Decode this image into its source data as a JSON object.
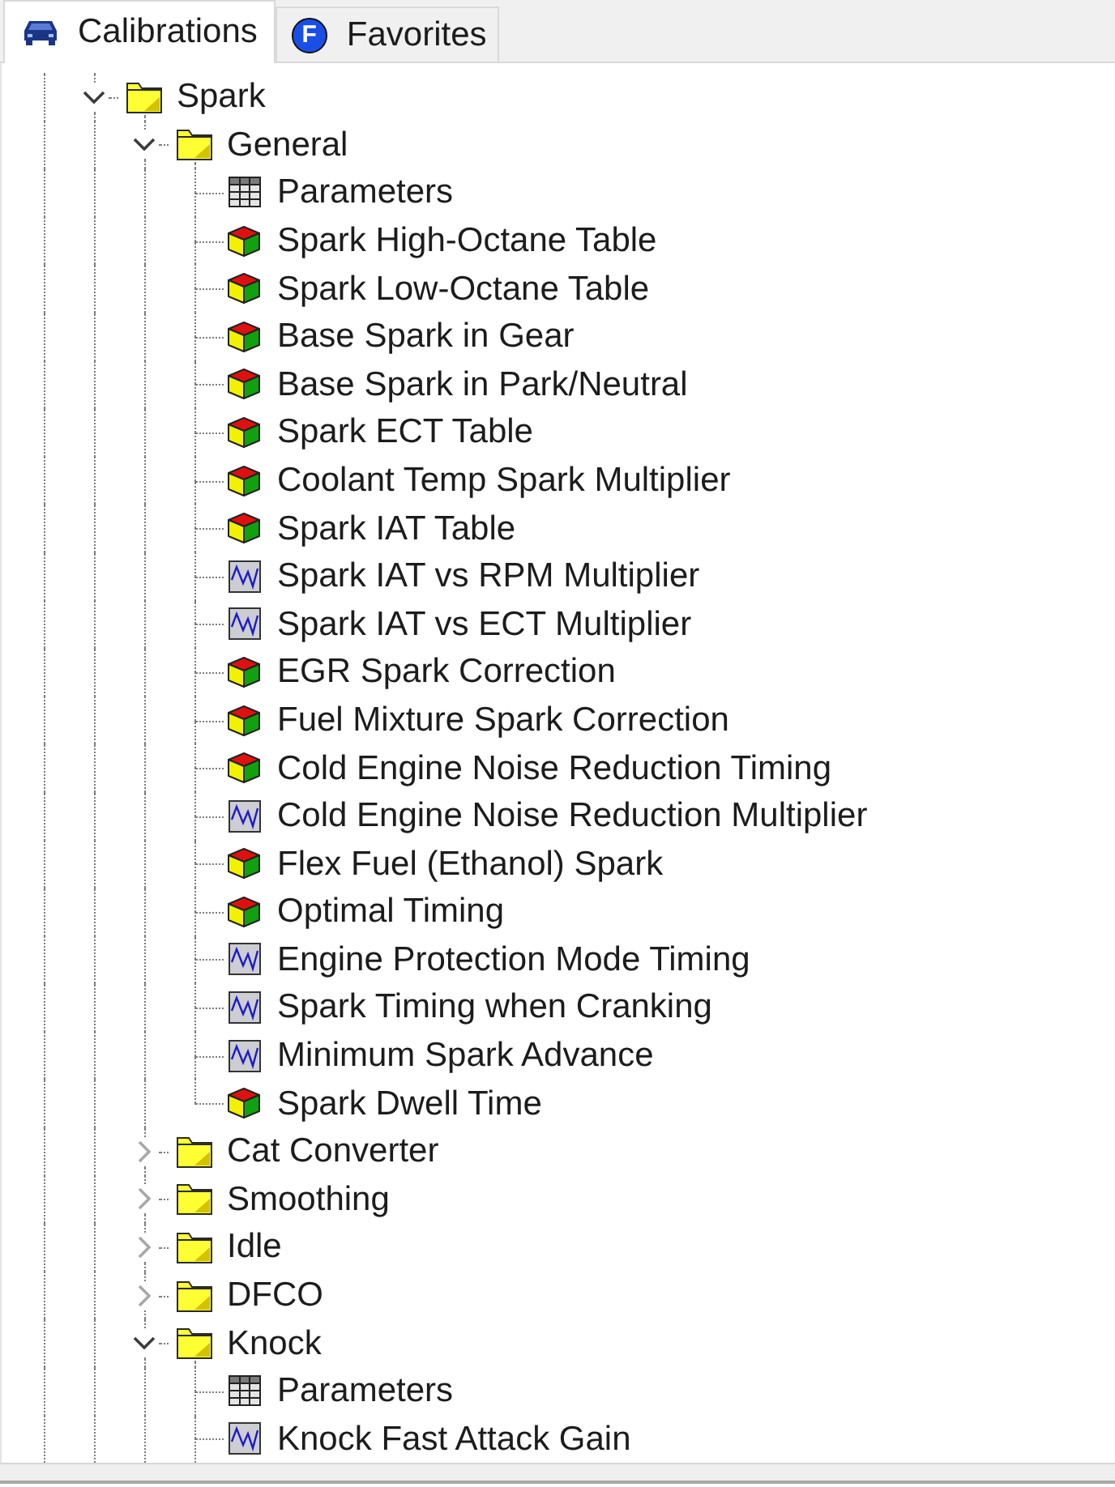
{
  "tabs": [
    {
      "label": "Calibrations",
      "selected": true,
      "icon": {
        "kind": "car"
      }
    },
    {
      "label": "Favorites",
      "selected": false,
      "icon": {
        "kind": "letter",
        "letter": "F"
      }
    }
  ],
  "tree": {
    "items": [
      {
        "label": "Spark",
        "kind": "folder",
        "expanded": true,
        "children": [
          {
            "label": "General",
            "kind": "folder",
            "expanded": true,
            "children": [
              {
                "label": "Parameters",
                "kind": "grid"
              },
              {
                "label": "Spark High-Octane Table",
                "kind": "cube"
              },
              {
                "label": "Spark Low-Octane Table",
                "kind": "cube"
              },
              {
                "label": "Base Spark in Gear",
                "kind": "cube"
              },
              {
                "label": "Base Spark in Park/Neutral",
                "kind": "cube"
              },
              {
                "label": "Spark ECT Table",
                "kind": "cube"
              },
              {
                "label": "Coolant Temp Spark Multiplier",
                "kind": "cube"
              },
              {
                "label": "Spark IAT Table",
                "kind": "cube"
              },
              {
                "label": "Spark IAT vs RPM Multiplier",
                "kind": "curve"
              },
              {
                "label": "Spark IAT vs ECT Multiplier",
                "kind": "curve"
              },
              {
                "label": "EGR Spark Correction",
                "kind": "cube"
              },
              {
                "label": "Fuel Mixture Spark Correction",
                "kind": "cube"
              },
              {
                "label": "Cold Engine Noise Reduction Timing",
                "kind": "cube"
              },
              {
                "label": "Cold Engine Noise Reduction Multiplier",
                "kind": "curve"
              },
              {
                "label": "Flex Fuel (Ethanol) Spark",
                "kind": "cube"
              },
              {
                "label": "Optimal Timing",
                "kind": "cube"
              },
              {
                "label": "Engine Protection Mode Timing",
                "kind": "curve"
              },
              {
                "label": "Spark Timing when Cranking",
                "kind": "curve"
              },
              {
                "label": "Minimum Spark Advance",
                "kind": "curve"
              },
              {
                "label": "Spark Dwell Time",
                "kind": "cube"
              }
            ]
          },
          {
            "label": "Cat Converter",
            "kind": "folder",
            "expanded": false
          },
          {
            "label": "Smoothing",
            "kind": "folder",
            "expanded": false
          },
          {
            "label": "Idle",
            "kind": "folder",
            "expanded": false
          },
          {
            "label": "DFCO",
            "kind": "folder",
            "expanded": false
          },
          {
            "label": "Knock",
            "kind": "folder",
            "expanded": true,
            "children": [
              {
                "label": "Parameters",
                "kind": "grid"
              },
              {
                "label": "Knock Fast Attack Gain",
                "kind": "curve"
              }
            ]
          }
        ]
      }
    ]
  }
}
